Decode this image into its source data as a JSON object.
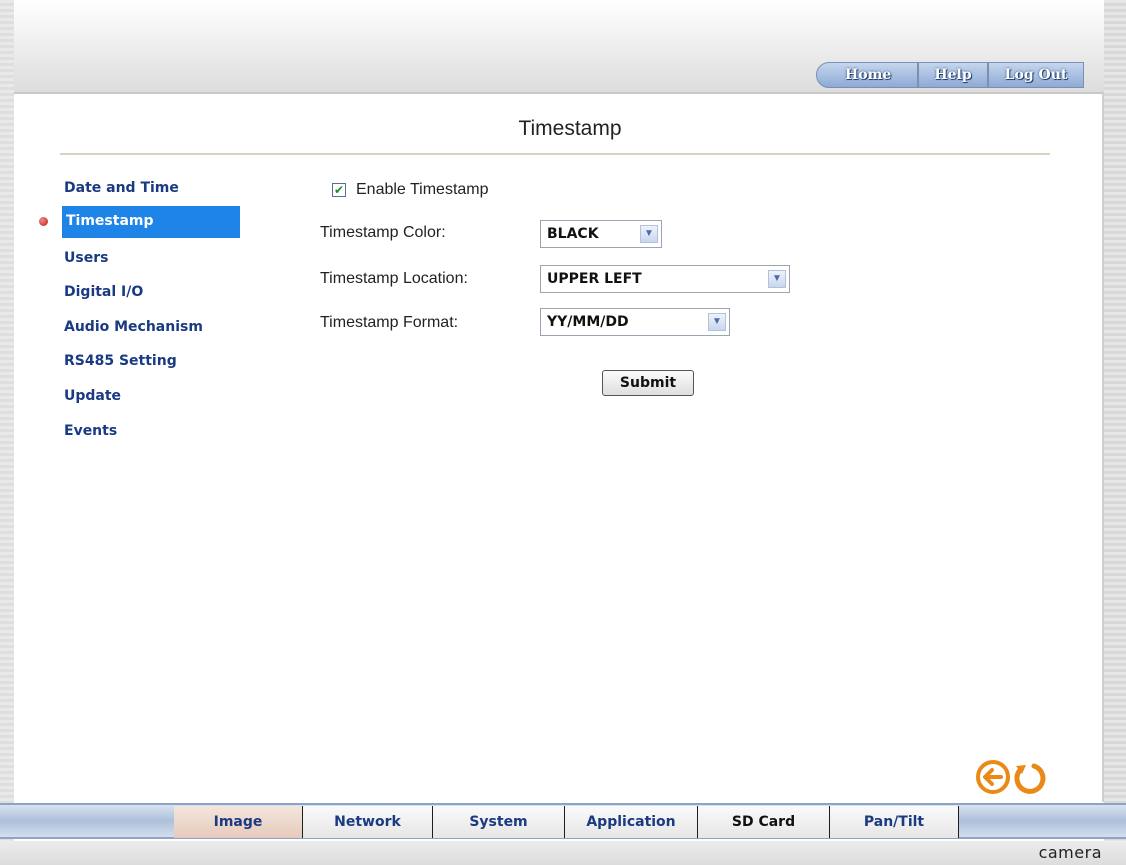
{
  "top_nav": {
    "home": "Home",
    "help": "Help",
    "logout": "Log Out"
  },
  "page": {
    "title": "Timestamp"
  },
  "sidebar": {
    "items": [
      {
        "label": "Date and Time"
      },
      {
        "label": "Timestamp",
        "active": true
      },
      {
        "label": "Users"
      },
      {
        "label": "Digital I/O"
      },
      {
        "label": "Audio Mechanism"
      },
      {
        "label": "RS485 Setting"
      },
      {
        "label": "Update"
      },
      {
        "label": "Events"
      }
    ]
  },
  "form": {
    "enable_timestamp": {
      "label": "Enable Timestamp",
      "checked": true
    },
    "color": {
      "label": "Timestamp Color:",
      "value": "BLACK"
    },
    "location": {
      "label": "Timestamp Location:",
      "value": "UPPER LEFT"
    },
    "format": {
      "label": "Timestamp Format:",
      "value": "YY/MM/DD"
    },
    "submit_label": "Submit"
  },
  "bottom_tabs": [
    {
      "label": "Image"
    },
    {
      "label": "Network"
    },
    {
      "label": "System"
    },
    {
      "label": "Application"
    },
    {
      "label": "SD Card"
    },
    {
      "label": "Pan/Tilt"
    }
  ],
  "footer": {
    "brand": "camera"
  },
  "colors": {
    "active_item_bg": "#1e84e8",
    "link_text": "#1a3a82",
    "icon_orange": "#e98a17"
  },
  "icons": {
    "back": "back-arrow-icon",
    "refresh": "refresh-icon",
    "checkbox": "checkmark-icon"
  }
}
